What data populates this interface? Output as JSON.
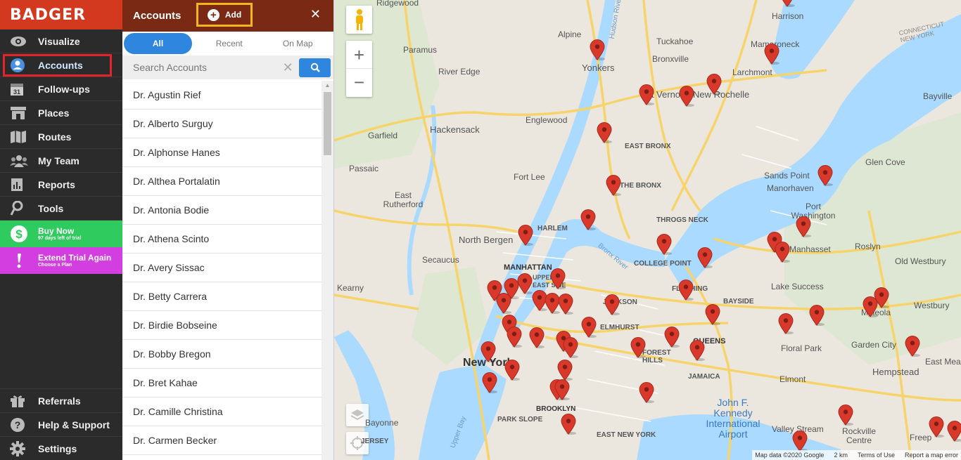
{
  "app": {
    "logo": "BADGER"
  },
  "nav": {
    "items": [
      {
        "label": "Visualize",
        "icon": "eye-icon"
      },
      {
        "label": "Accounts",
        "icon": "user-circle-icon",
        "active": true
      },
      {
        "label": "Follow-ups",
        "icon": "calendar-icon",
        "badge": "31"
      },
      {
        "label": "Places",
        "icon": "store-icon"
      },
      {
        "label": "Routes",
        "icon": "map-icon"
      },
      {
        "label": "My Team",
        "icon": "team-icon"
      },
      {
        "label": "Reports",
        "icon": "reports-icon"
      },
      {
        "label": "Tools",
        "icon": "tools-icon"
      }
    ],
    "buy_now": {
      "label": "Buy Now",
      "sub": "97 days left of trial",
      "color": "#2fcb5e"
    },
    "extend": {
      "label": "Extend Trial Again",
      "sub": "Choose a Plan",
      "color": "#d23ee0"
    },
    "bottom": [
      {
        "label": "Referrals",
        "icon": "gift-icon"
      },
      {
        "label": "Help & Support",
        "icon": "help-icon"
      },
      {
        "label": "Settings",
        "icon": "gear-icon"
      }
    ]
  },
  "panel": {
    "title": "Accounts",
    "add_label": "Add",
    "tabs": [
      "All",
      "Recent",
      "On Map"
    ],
    "search_placeholder": "Search Accounts",
    "accounts": [
      "Dr. Agustin Rief",
      "Dr. Alberto Surguy",
      "Dr. Alphonse Hanes",
      "Dr. Althea Portalatin",
      "Dr. Antonia Bodie",
      "Dr. Athena Scinto",
      "Dr. Avery Sissac",
      "Dr. Betty Carrera",
      "Dr. Birdie Bobseine",
      "Dr. Bobby Bregon",
      "Dr. Bret Kahae",
      "Dr. Camille Christina",
      "Dr. Carmen Becker"
    ]
  },
  "map": {
    "labels": {
      "ridgewood": "Ridgewood",
      "alpine": "Alpine",
      "paramus": "Paramus",
      "river_edge": "River Edge",
      "hackensack": "Hackensack",
      "englewood": "Englewood",
      "garfield": "Garfield",
      "passaic": "Passaic",
      "fort_lee": "Fort Lee",
      "east_rutherford": "East Rutherford",
      "north_bergen": "North Bergen",
      "secaucus": "Secaucus",
      "kearny": "Kearny",
      "manhattan": "MANHATTAN",
      "harlem": "HARLEM",
      "upper_east_side": "UPPER EAST SIDE",
      "new_york": "New York",
      "brooklyn": "BROOKLYN",
      "park_slope": "PARK SLOPE",
      "bayonne": "Bayonne",
      "jersey": "JERSEY",
      "yonkers": "Yonkers",
      "tuckahoe": "Tuckahoe",
      "bronxville": "Bronxville",
      "mt_vernon": "Mt Vernon",
      "new_rochelle": "New Rochelle",
      "larchmont": "Larchmont",
      "mamaroneck": "Mamaroneck",
      "harrison": "Harrison",
      "connecticut": "CONNECTICUT NEW YORK",
      "bayville": "Bayville",
      "east_bronx": "EAST BRONX",
      "the_bronx": "THE BRONX",
      "throgs_neck": "THROGS NECK",
      "college_point": "COLLEGE POINT",
      "flushing": "FLUSHING",
      "bayside": "BAYSIDE",
      "jackson": "JACKSON",
      "elmhurst": "ELMHURST",
      "queens": "QUEENS",
      "jamaica": "JAMAICA",
      "forest_hills": "FOREST HILLS",
      "east_new_york": "EAST NEW YORK",
      "glen_cove": "Glen Cove",
      "sands_point": "Sands Point",
      "manorhaven": "Manorhaven",
      "port_washington": "Port Washington",
      "manhasset": "Manhasset",
      "roslyn": "Roslyn",
      "old_westbury": "Old Westbury",
      "lake_success": "Lake Success",
      "westbury": "Westbury",
      "mineola": "Mineola",
      "floral_park": "Floral Park",
      "garden_city": "Garden City",
      "hempstead": "Hempstead",
      "east_meadow": "East Meado",
      "elmont": "Elmont",
      "valley_stream": "Valley Stream",
      "rockville_centre": "Rockville Centre",
      "freeport": "Freep",
      "jfk": "John F. Kennedy International Airport",
      "upper_bay": "Upper Bay",
      "bronx_river": "Bronx River",
      "hudson_river": "Hudson River"
    },
    "attribution": [
      "Map data ©2020 Google",
      "2 km",
      "Terms of Use",
      "Report a map error"
    ],
    "pin_color": "#d9392b"
  }
}
